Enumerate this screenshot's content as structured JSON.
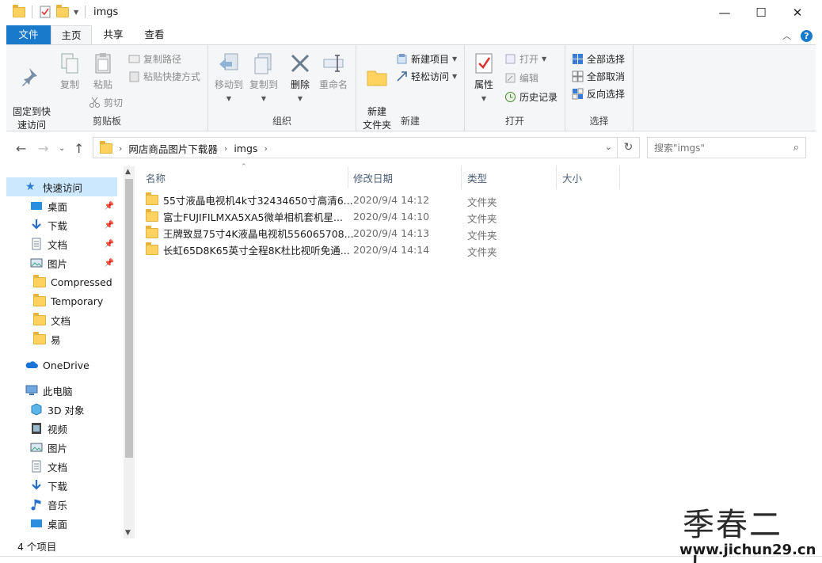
{
  "window": {
    "title": "imgs",
    "minimize_glyph": "—",
    "maximize_glyph": "☐",
    "close_glyph": "✕"
  },
  "ribbon_tabs": {
    "file": "文件",
    "home": "主页",
    "share": "共享",
    "view": "查看"
  },
  "ribbon": {
    "clipboard": {
      "label": "剪贴板",
      "pin": "固定到快\n速访问",
      "copy": "复制",
      "paste": "粘贴",
      "copy_path": "复制路径",
      "paste_shortcut": "粘贴快捷方式",
      "cut": "剪切"
    },
    "organize": {
      "label": "组织",
      "move_to": "移动到",
      "copy_to": "复制到",
      "delete": "删除",
      "rename": "重命名"
    },
    "new": {
      "label": "新建",
      "new_folder": "新建\n文件夹",
      "new_item": "新建项目",
      "easy_access": "轻松访问"
    },
    "open": {
      "label": "打开",
      "properties": "属性",
      "open": "打开",
      "edit": "编辑",
      "history": "历史记录"
    },
    "select": {
      "label": "选择",
      "select_all": "全部选择",
      "select_none": "全部取消",
      "invert": "反向选择"
    }
  },
  "address": {
    "crumbs": [
      "网店商品图片下载器",
      "imgs"
    ]
  },
  "search": {
    "placeholder": "搜索\"imgs\""
  },
  "nav": {
    "quick_access": "快速访问",
    "items": [
      {
        "label": "桌面",
        "icon": "desktop-icon",
        "pinned": true
      },
      {
        "label": "下载",
        "icon": "download-icon",
        "pinned": true
      },
      {
        "label": "文档",
        "icon": "document-icon",
        "pinned": true
      },
      {
        "label": "图片",
        "icon": "picture-icon",
        "pinned": true
      },
      {
        "label": "Compressed",
        "icon": "folder-icon",
        "pinned": false
      },
      {
        "label": "Temporary",
        "icon": "folder-icon",
        "pinned": false
      },
      {
        "label": "文档",
        "icon": "folder-icon",
        "pinned": false
      },
      {
        "label": "易",
        "icon": "folder-icon",
        "pinned": false
      }
    ],
    "onedrive": "OneDrive",
    "this_pc": "此电脑",
    "pc_items": [
      {
        "label": "3D 对象",
        "icon": "cube-icon"
      },
      {
        "label": "视频",
        "icon": "video-icon"
      },
      {
        "label": "图片",
        "icon": "picture-icon"
      },
      {
        "label": "文档",
        "icon": "document-icon"
      },
      {
        "label": "下载",
        "icon": "download-icon"
      },
      {
        "label": "音乐",
        "icon": "music-icon"
      },
      {
        "label": "桌面",
        "icon": "desktop-icon"
      }
    ]
  },
  "columns": {
    "name": "名称",
    "date": "修改日期",
    "type": "类型",
    "size": "大小"
  },
  "files": [
    {
      "name": "55寸液晶电视机4k寸32434650寸高清6...",
      "date": "2020/9/4 14:12",
      "type": "文件夹"
    },
    {
      "name": "富士FUJIFILMXA5XA5微单相机套机星...",
      "date": "2020/9/4 14:10",
      "type": "文件夹"
    },
    {
      "name": "王牌致显75寸4K液晶电视机556065708...",
      "date": "2020/9/4 14:13",
      "type": "文件夹"
    },
    {
      "name": "长虹65D8K65英寸全程8K杜比视听免通...",
      "date": "2020/9/4 14:14",
      "type": "文件夹"
    }
  ],
  "status": {
    "count": "4 个项目"
  },
  "watermark": {
    "big": "季春二九",
    "small": "www.jichun29.cn"
  },
  "colors": {
    "accent": "#1979ca",
    "selected": "#cce8ff",
    "folder": "#ffd25f"
  }
}
